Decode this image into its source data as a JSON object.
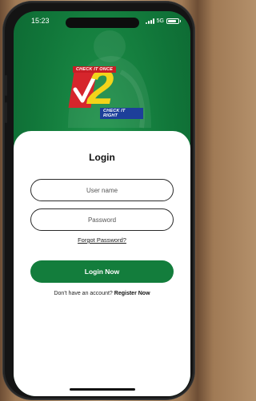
{
  "status_bar": {
    "time": "15:23",
    "network": "5G",
    "battery_label": "87",
    "battery_level_percent": 87
  },
  "logo": {
    "top_tagline": "CHECK IT ONCE",
    "mark_number": "2",
    "bottom_tagline": "CHECK IT RIGHT",
    "colors": {
      "red": "#d6252c",
      "yellow": "#f3d41a",
      "blue": "#1d3f9a"
    }
  },
  "login": {
    "title": "Login",
    "username_placeholder": "User name",
    "password_placeholder": "Password",
    "forgot_password": "Forgot Password?",
    "submit_label": "Login Now",
    "no_account_text": "Don't have an account?",
    "register_label": "Register Now"
  },
  "colors": {
    "brand_green": "#137d3c",
    "background_green": "#11773a"
  }
}
